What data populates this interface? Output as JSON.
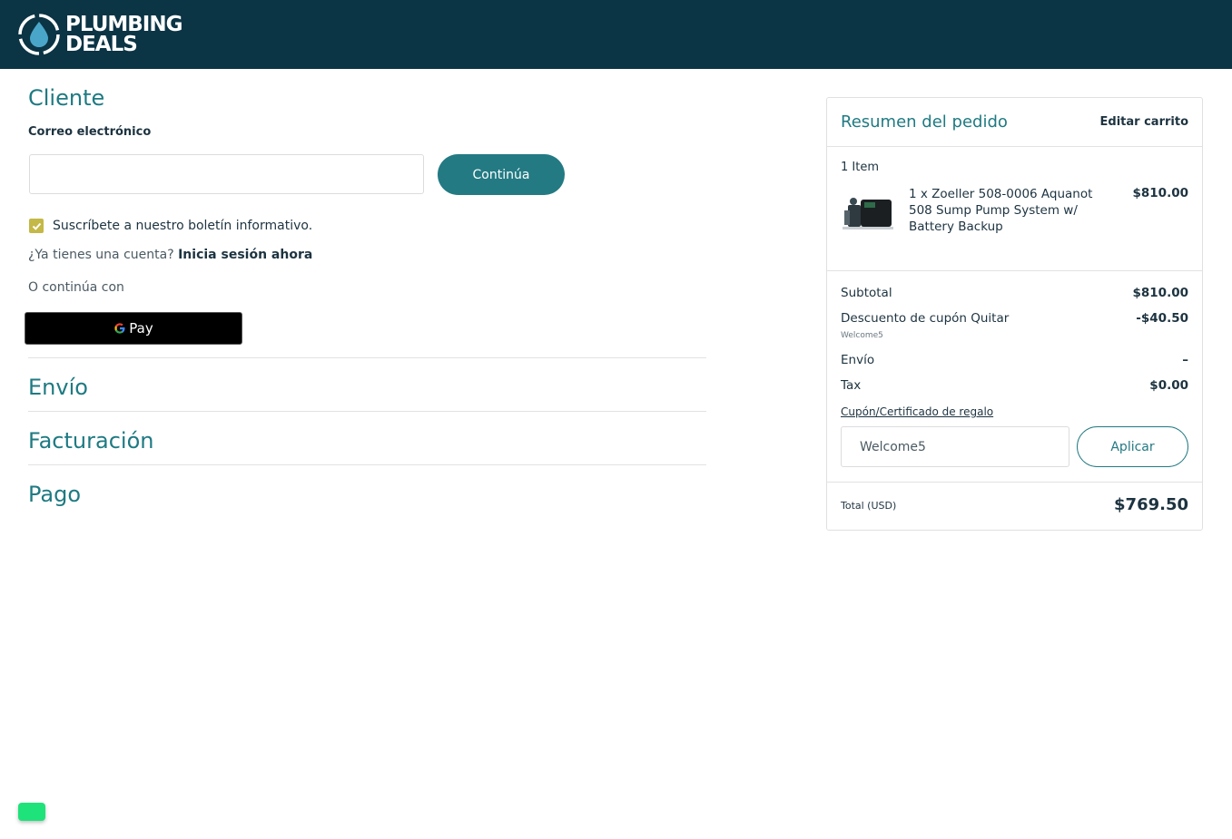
{
  "header": {
    "logo_line1": "PLUMBING",
    "logo_line2": "DEALS",
    "bg_color": "#0b3445"
  },
  "checkout": {
    "customer_title": "Cliente",
    "email_label": "Correo electrónico",
    "email_value": "",
    "continue_label": "Continúa",
    "newsletter_label": "Suscríbete a nuestro boletín informativo.",
    "newsletter_checked": true,
    "account_prompt": "¿Ya tienes una cuenta?",
    "login_link": "Inicia sesión ahora",
    "continue_with": "O continúa con",
    "gpay_label": "Pay",
    "shipping_title": "Envío",
    "billing_title": "Facturación",
    "payment_title": "Pago"
  },
  "summary": {
    "title": "Resumen del pedido",
    "edit_cart": "Editar carrito",
    "item_count": "1 Item",
    "item": {
      "name": "1 x Zoeller 508-0006 Aquanot 508 Sump Pump System w/ Battery Backup",
      "price": "$810.00"
    },
    "subtotal_label": "Subtotal",
    "subtotal_value": "$810.00",
    "discount_label": "Descuento de cupón Quitar",
    "discount_value": "-$40.50",
    "discount_code": "Welcome5",
    "shipping_label": "Envío",
    "shipping_value": "–",
    "tax_label": "Tax",
    "tax_value": "$0.00",
    "coupon_link": "Cupón/Certificado de regalo",
    "coupon_input_value": "Welcome5",
    "apply_label": "Aplicar",
    "total_label": "Total (USD)",
    "total_value": "$769.50"
  },
  "colors": {
    "accent": "#237a83",
    "heading": "#1e7a82",
    "checkbox": "#c4b846",
    "chat_widget": "#1ee37a"
  }
}
